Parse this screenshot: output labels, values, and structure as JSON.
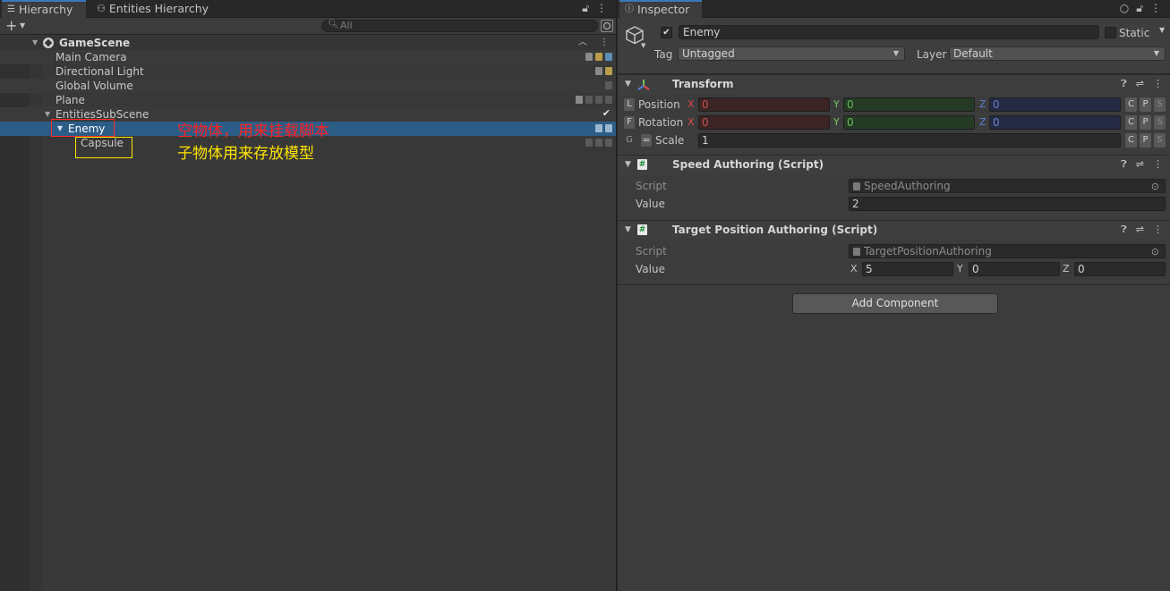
{
  "hierarchy": {
    "tabs": [
      {
        "label": "Hierarchy",
        "icon": "list-icon"
      },
      {
        "label": "Entities Hierarchy",
        "icon": "entities-icon"
      }
    ],
    "search_placeholder": "All",
    "scene": "GameScene",
    "items": [
      {
        "label": "Main Camera"
      },
      {
        "label": "Directional Light"
      },
      {
        "label": "Global Volume"
      },
      {
        "label": "Plane"
      },
      {
        "label": "EntitiesSubScene"
      },
      {
        "label": "Enemy"
      },
      {
        "label": "Capsule"
      }
    ]
  },
  "annotations": {
    "enemy_note": "空物体，用来挂载脚本",
    "capsule_note": "子物体用来存放模型"
  },
  "inspector": {
    "tab": "Inspector",
    "object_name": "Enemy",
    "static_label": "Static",
    "tag_label": "Tag",
    "tag_value": "Untagged",
    "layer_label": "Layer",
    "layer_value": "Default",
    "transform": {
      "title": "Transform",
      "rows": [
        {
          "badge": "L",
          "label": "Position",
          "x": "0",
          "y": "0",
          "z": "0"
        },
        {
          "badge": "F",
          "label": "Rotation",
          "x": "0",
          "y": "0",
          "z": "0"
        },
        {
          "badge": "G",
          "label": "Scale",
          "value": "1"
        }
      ],
      "axis_x": "X",
      "axis_y": "Y",
      "axis_z": "Z",
      "c": "C",
      "p": "P",
      "s": "S"
    },
    "speed": {
      "title": "Speed Authoring (Script)",
      "script_label": "Script",
      "script_value": "SpeedAuthoring",
      "value_label": "Value",
      "value": "2"
    },
    "target": {
      "title": "Target Position Authoring (Script)",
      "script_label": "Script",
      "script_value": "TargetPositionAuthoring",
      "value_label": "Value",
      "x": "5",
      "y": "0",
      "z": "0"
    },
    "add_component": "Add Component"
  }
}
